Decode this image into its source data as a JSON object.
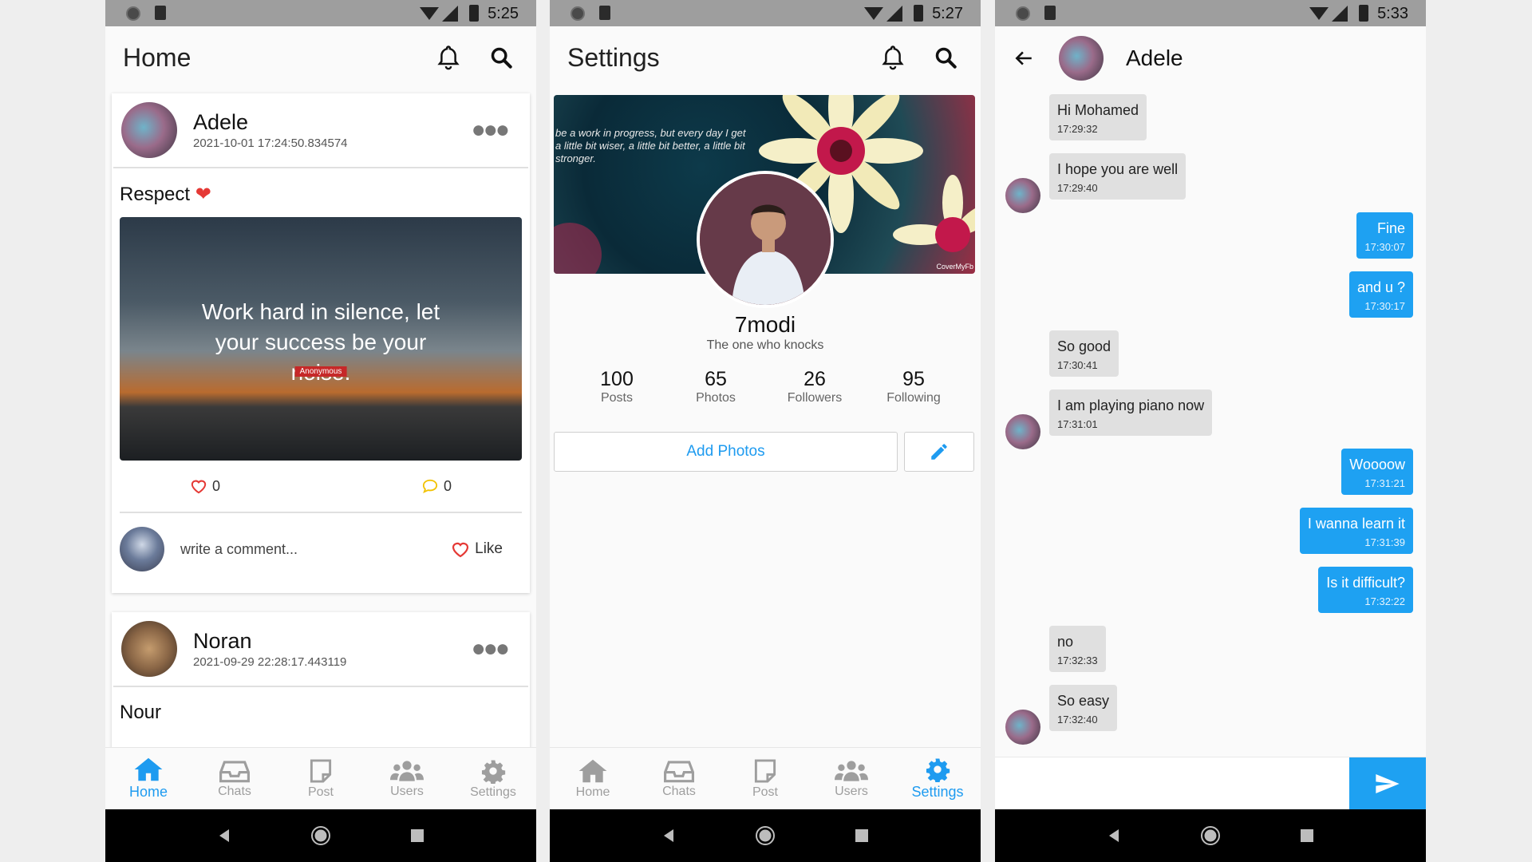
{
  "status": {
    "time1": "5:25",
    "time2": "5:27",
    "time3": "5:33"
  },
  "home": {
    "title": "Home",
    "posts": [
      {
        "author": "Adele",
        "time": "2021-10-01 17:24:50.834574",
        "text": "Respect",
        "image_quote": "Work hard in silence, let your success be your noise.",
        "image_author": "Anonymous",
        "likes": "0",
        "comments": "0"
      },
      {
        "author": "Noran",
        "time": "2021-09-29 22:28:17.443119",
        "text": "Nour"
      }
    ],
    "comment_placeholder": "write a comment...",
    "like_label": "Like"
  },
  "settings": {
    "title": "Settings",
    "cover_text": "be a work in progress, but every day I get a little bit wiser, a little bit better, a little bit stronger.",
    "cover_credit": "CoverMyFb",
    "name": "7modi",
    "bio": "The one who knocks",
    "counts": [
      {
        "value": "100",
        "label": "Posts"
      },
      {
        "value": "65",
        "label": "Photos"
      },
      {
        "value": "26",
        "label": "Followers"
      },
      {
        "value": "95",
        "label": "Following"
      }
    ],
    "add_photos": "Add Photos"
  },
  "nav": [
    "Home",
    "Chats",
    "Post",
    "Users",
    "Settings"
  ],
  "chat": {
    "name": "Adele",
    "messages": [
      {
        "dir": "in",
        "text": "Hi Mohamed",
        "time": "17:29:32"
      },
      {
        "dir": "in",
        "text": "I hope you are well",
        "time": "17:29:40"
      },
      {
        "dir": "out",
        "text": "Fine",
        "time": "17:30:07"
      },
      {
        "dir": "out",
        "text": "and u ?",
        "time": "17:30:17"
      },
      {
        "dir": "in",
        "text": "So good",
        "time": "17:30:41"
      },
      {
        "dir": "in",
        "text": "I am playing piano now",
        "time": "17:31:01"
      },
      {
        "dir": "out",
        "text": "Woooow",
        "time": "17:31:21"
      },
      {
        "dir": "out",
        "text": "I wanna learn it",
        "time": "17:31:39"
      },
      {
        "dir": "out",
        "text": "Is it difficult?",
        "time": "17:32:22"
      },
      {
        "dir": "in",
        "text": "no",
        "time": "17:32:33"
      },
      {
        "dir": "in",
        "text": "So easy",
        "time": "17:32:40"
      }
    ]
  },
  "colors": {
    "accent": "#1ea1f2",
    "status_bar": "#9e9e9e",
    "like": "#e53935",
    "comment": "#f2c200"
  }
}
